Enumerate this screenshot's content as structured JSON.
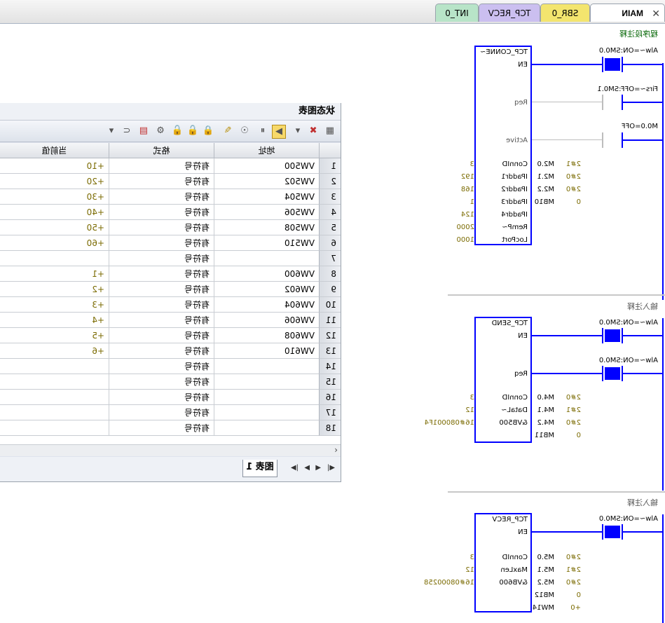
{
  "tabs": [
    {
      "label": "MAIN"
    },
    {
      "label": "SBR_0"
    },
    {
      "label": "TCP_RECV"
    },
    {
      "label": "INT_0"
    }
  ],
  "ladder": {
    "network1": {
      "comment": "程序段注释",
      "block_name": "TCP_CONNE~",
      "en": "EN",
      "req": "Req",
      "active": "Active",
      "contact1": {
        "name": "Alw~=ON:SM0.0"
      },
      "contact2": {
        "name": "Firs~=OFF:SM0.1"
      },
      "contact3": {
        "name": "M0.0=OFF"
      },
      "inputs": [
        {
          "pin": "ConnID",
          "value": "3"
        },
        {
          "pin": "IPaddr1",
          "value": "192"
        },
        {
          "pin": "IPaddr2",
          "value": "168"
        },
        {
          "pin": "IPaddr3",
          "value": "1"
        },
        {
          "pin": "IPaddr4",
          "value": "124"
        },
        {
          "pin": "RemP~",
          "value": "2000"
        },
        {
          "pin": "LocPort",
          "value": "1000"
        }
      ],
      "outputs": [
        {
          "addr": "M2.0",
          "value": "2#1"
        },
        {
          "addr": "M2.1",
          "value": "2#0"
        },
        {
          "addr": "M2.2",
          "value": "2#0"
        },
        {
          "addr": "MB10",
          "value": "0"
        }
      ]
    },
    "network2": {
      "comment": "输入注释",
      "block_name": "TCP_SEND",
      "en": "EN",
      "req": "Req",
      "contact1": {
        "name": "Alw~=ON:SM0.0"
      },
      "contact2": {
        "name": "Alw~=ON:SM0.0"
      },
      "inputs": [
        {
          "pin": "ConnID",
          "value": "3"
        },
        {
          "pin": "DataL~",
          "value": "12"
        },
        {
          "pin": "&VB500",
          "value": "16#080001F4"
        }
      ],
      "outputs": [
        {
          "addr": "M4.0",
          "value": "2#0"
        },
        {
          "addr": "M4.1",
          "value": "2#1"
        },
        {
          "addr": "M4.2",
          "value": "2#0"
        },
        {
          "addr": "MB11",
          "value": "0"
        }
      ]
    },
    "network3": {
      "comment": "输入注释",
      "block_name": "TCP_RECV",
      "en": "EN",
      "contact1": {
        "name": "Alw~=ON:SM0.0"
      },
      "inputs": [
        {
          "pin": "ConnID",
          "value": "3"
        },
        {
          "pin": "MaxLen",
          "value": "12"
        },
        {
          "pin": "&VB600",
          "value": "16#08000258"
        }
      ],
      "outputs": [
        {
          "addr": "M5.0",
          "value": "2#0"
        },
        {
          "addr": "M5.1",
          "value": "2#1"
        },
        {
          "addr": "M5.2",
          "value": "2#0"
        },
        {
          "addr": "MB12",
          "value": "0"
        },
        {
          "addr": "MW14",
          "value": "+0"
        }
      ]
    }
  },
  "status_chart": {
    "title": "状态图表",
    "columns": [
      "地址",
      "格式",
      "当前值"
    ],
    "rows": [
      {
        "n": "1",
        "addr": "VW500",
        "fmt": "有符号",
        "val": "+10"
      },
      {
        "n": "2",
        "addr": "VW502",
        "fmt": "有符号",
        "val": "+20"
      },
      {
        "n": "3",
        "addr": "VW504",
        "fmt": "有符号",
        "val": "+30"
      },
      {
        "n": "4",
        "addr": "VW506",
        "fmt": "有符号",
        "val": "+40"
      },
      {
        "n": "5",
        "addr": "VW508",
        "fmt": "有符号",
        "val": "+50"
      },
      {
        "n": "6",
        "addr": "VW510",
        "fmt": "有符号",
        "val": "+60"
      },
      {
        "n": "7",
        "addr": "",
        "fmt": "有符号",
        "val": ""
      },
      {
        "n": "8",
        "addr": "VW600",
        "fmt": "有符号",
        "val": "+1"
      },
      {
        "n": "9",
        "addr": "VW602",
        "fmt": "有符号",
        "val": "+2"
      },
      {
        "n": "10",
        "addr": "VW604",
        "fmt": "有符号",
        "val": "+3"
      },
      {
        "n": "11",
        "addr": "VW606",
        "fmt": "有符号",
        "val": "+4"
      },
      {
        "n": "12",
        "addr": "VW608",
        "fmt": "有符号",
        "val": "+5"
      },
      {
        "n": "13",
        "addr": "VW610",
        "fmt": "有符号",
        "val": "+6"
      },
      {
        "n": "14",
        "addr": "",
        "fmt": "有符号",
        "val": ""
      },
      {
        "n": "15",
        "addr": "",
        "fmt": "有符号",
        "val": ""
      },
      {
        "n": "16",
        "addr": "",
        "fmt": "有符号",
        "val": ""
      },
      {
        "n": "17",
        "addr": "",
        "fmt": "有符号",
        "val": ""
      },
      {
        "n": "18",
        "addr": "",
        "fmt": "有符号",
        "val": ""
      }
    ],
    "sheet_tab": "图表 1"
  },
  "colors": {
    "ladder": "#0000ff",
    "value": "#7a6a00"
  }
}
